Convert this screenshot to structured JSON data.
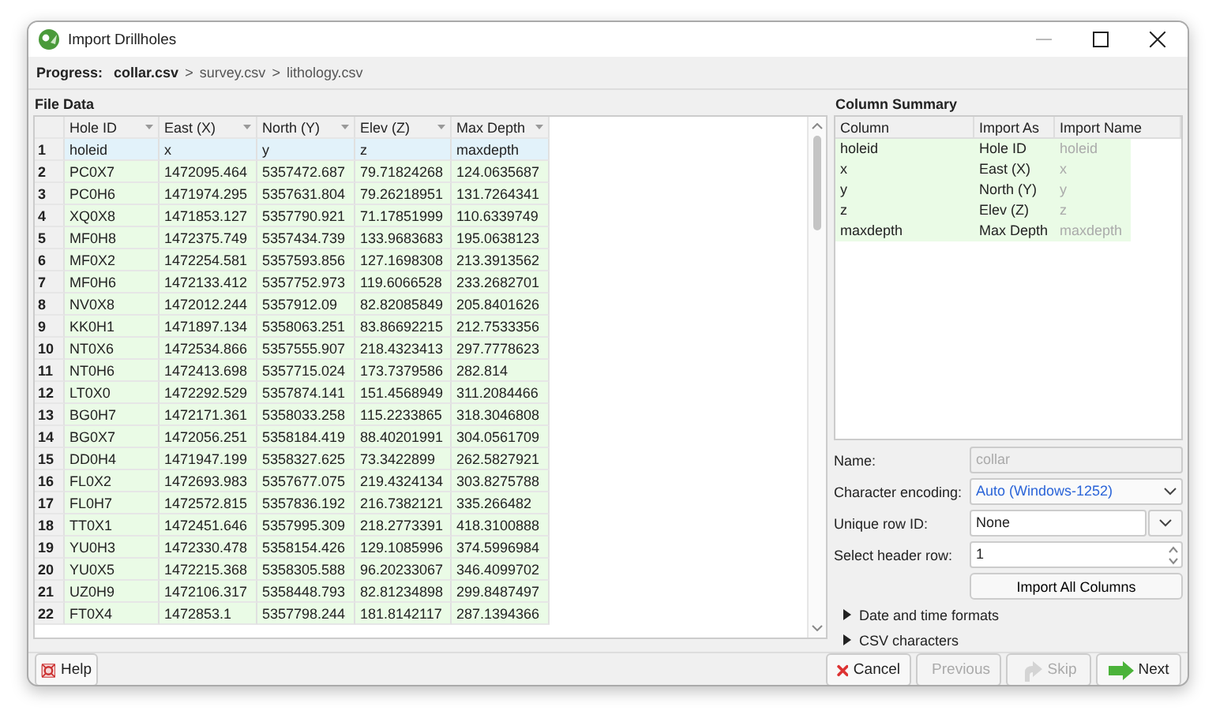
{
  "window": {
    "title": "Import Drillholes"
  },
  "progress": {
    "label": "Progress:",
    "separator": ">",
    "steps": [
      {
        "label": "collar.csv",
        "current": true
      },
      {
        "label": "survey.csv",
        "current": false
      },
      {
        "label": "lithology.csv",
        "current": false
      }
    ]
  },
  "file_data": {
    "title": "File Data",
    "columns": [
      "Hole ID",
      "East (X)",
      "North (Y)",
      "Elev (Z)",
      "Max Depth"
    ],
    "rows": [
      {
        "number": "1",
        "kind": "header",
        "cells": [
          "holeid",
          "x",
          "y",
          "z",
          "maxdepth"
        ]
      },
      {
        "number": "2",
        "kind": "data",
        "cells": [
          "PC0X7",
          "1472095.464",
          "5357472.687",
          "79.71824268",
          "124.0635687"
        ]
      },
      {
        "number": "3",
        "kind": "data",
        "cells": [
          "PC0H6",
          "1471974.295",
          "5357631.804",
          "79.26218951",
          "131.7264341"
        ]
      },
      {
        "number": "4",
        "kind": "data",
        "cells": [
          "XQ0X8",
          "1471853.127",
          "5357790.921",
          "71.17851999",
          "110.6339749"
        ]
      },
      {
        "number": "5",
        "kind": "data",
        "cells": [
          "MF0H8",
          "1472375.749",
          "5357434.739",
          "133.9683683",
          "195.0638123"
        ]
      },
      {
        "number": "6",
        "kind": "data",
        "cells": [
          "MF0X2",
          "1472254.581",
          "5357593.856",
          "127.1698308",
          "213.3913562"
        ]
      },
      {
        "number": "7",
        "kind": "data",
        "cells": [
          "MF0H6",
          "1472133.412",
          "5357752.973",
          "119.6066528",
          "233.2682701"
        ]
      },
      {
        "number": "8",
        "kind": "data",
        "cells": [
          "NV0X8",
          "1472012.244",
          "5357912.09",
          "82.82085849",
          "205.8401626"
        ]
      },
      {
        "number": "9",
        "kind": "data",
        "cells": [
          "KK0H1",
          "1471897.134",
          "5358063.251",
          "83.86692215",
          "212.7533356"
        ]
      },
      {
        "number": "10",
        "kind": "data",
        "cells": [
          "NT0X6",
          "1472534.866",
          "5357555.907",
          "218.4323413",
          "297.7778623"
        ]
      },
      {
        "number": "11",
        "kind": "data",
        "cells": [
          "NT0H6",
          "1472413.698",
          "5357715.024",
          "173.7379586",
          "282.814"
        ]
      },
      {
        "number": "12",
        "kind": "data",
        "cells": [
          "LT0X0",
          "1472292.529",
          "5357874.141",
          "151.4568949",
          "311.2084466"
        ]
      },
      {
        "number": "13",
        "kind": "data",
        "cells": [
          "BG0H7",
          "1472171.361",
          "5358033.258",
          "115.2233865",
          "318.3046808"
        ]
      },
      {
        "number": "14",
        "kind": "data",
        "cells": [
          "BG0X7",
          "1472056.251",
          "5358184.419",
          "88.40201991",
          "304.0561709"
        ]
      },
      {
        "number": "15",
        "kind": "data",
        "cells": [
          "DD0H4",
          "1471947.199",
          "5358327.625",
          "73.3422899",
          "262.5827921"
        ]
      },
      {
        "number": "16",
        "kind": "data",
        "cells": [
          "FL0X2",
          "1472693.983",
          "5357677.075",
          "219.4324134",
          "303.8275788"
        ]
      },
      {
        "number": "17",
        "kind": "data",
        "cells": [
          "FL0H7",
          "1472572.815",
          "5357836.192",
          "216.7382121",
          "335.266482"
        ]
      },
      {
        "number": "18",
        "kind": "data",
        "cells": [
          "TT0X1",
          "1472451.646",
          "5357995.309",
          "218.2773391",
          "418.3100888"
        ]
      },
      {
        "number": "19",
        "kind": "data",
        "cells": [
          "YU0H3",
          "1472330.478",
          "5358154.426",
          "129.1085996",
          "374.5996984"
        ]
      },
      {
        "number": "20",
        "kind": "data",
        "cells": [
          "YU0X5",
          "1472215.368",
          "5358305.588",
          "96.20233067",
          "346.4099702"
        ]
      },
      {
        "number": "21",
        "kind": "data",
        "cells": [
          "UZ0H9",
          "1472106.317",
          "5358448.793",
          "82.81234898",
          "299.8487497"
        ]
      },
      {
        "number": "22",
        "kind": "data",
        "cells": [
          "FT0X4",
          "1472853.1",
          "5357798.244",
          "181.8142117",
          "287.1394366"
        ]
      }
    ]
  },
  "column_summary": {
    "title": "Column Summary",
    "columns": [
      "Column",
      "Import As",
      "Import Name"
    ],
    "rows": [
      {
        "column": "holeid",
        "import_as": "Hole ID",
        "import_name": "holeid"
      },
      {
        "column": "x",
        "import_as": "East (X)",
        "import_name": "x"
      },
      {
        "column": "y",
        "import_as": "North (Y)",
        "import_name": "y"
      },
      {
        "column": "z",
        "import_as": "Elev (Z)",
        "import_name": "z"
      },
      {
        "column": "maxdepth",
        "import_as": "Max Depth",
        "import_name": "maxdepth"
      }
    ]
  },
  "form": [
    {
      "kind": "text",
      "label": "Name:",
      "value": "collar",
      "disabled": true
    },
    {
      "kind": "select",
      "label": "Character encoding:",
      "value": "Auto (Windows-1252)"
    },
    {
      "kind": "combo",
      "label": "Unique row ID:",
      "value": "None"
    },
    {
      "kind": "spin",
      "label": "Select header row:",
      "value": "1"
    }
  ],
  "import_all_button": "Import All Columns",
  "sections": [
    {
      "label": "Date and time formats",
      "expanded": false
    },
    {
      "label": "CSV characters",
      "expanded": false
    }
  ],
  "buttons": [
    {
      "kind": "help",
      "label": "Help",
      "disabled": false
    },
    {
      "kind": "cancel",
      "label": "Cancel",
      "disabled": false
    },
    {
      "kind": "previous",
      "label": "Previous",
      "disabled": true
    },
    {
      "kind": "skip",
      "label": "Skip",
      "disabled": true
    },
    {
      "kind": "next",
      "label": "Next",
      "disabled": false
    }
  ]
}
